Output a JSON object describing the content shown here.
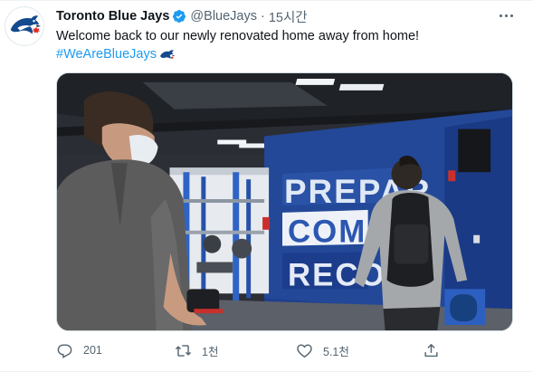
{
  "tweet": {
    "display_name": "Toronto Blue Jays",
    "handle": "@BlueJays",
    "separator": "·",
    "time": "15시간",
    "text": "Welcome back to our newly renovated home away from home!",
    "hashtag": "#WeAreBlueJays",
    "media": {
      "wall_text": [
        "PREPAR",
        "COMP",
        "RECO"
      ]
    },
    "actions": {
      "reply_count": "201",
      "retweet_count": "1천",
      "like_count": "5.1천"
    }
  },
  "colors": {
    "link": "#1d9bf0",
    "secondary_text": "#536471",
    "primary_text": "#0f1419",
    "jays_blue": "#134a8e",
    "jays_red": "#e8291c"
  },
  "icons": {
    "avatar": "blue-jays-logo",
    "verified": "verified-badge-icon",
    "more": "more-dots-icon",
    "hashflag": "blue-jays-hashflag-icon",
    "reply": "reply-icon",
    "retweet": "retweet-icon",
    "like": "heart-icon",
    "share": "share-icon"
  }
}
